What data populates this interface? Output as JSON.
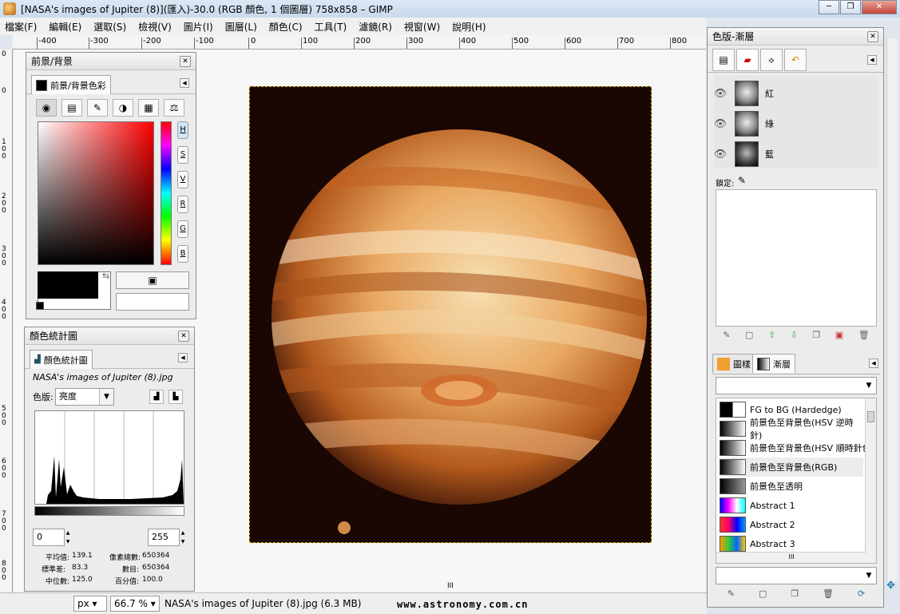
{
  "window": {
    "title": "[NASA's images of Jupiter (8)](匯入)-30.0 (RGB 顏色, 1 個圖層) 758x858 – GIMP",
    "minimize": "─",
    "maximize": "❐",
    "close": "✕"
  },
  "menubar": [
    "檔案(F)",
    "編輯(E)",
    "選取(S)",
    "檢視(V)",
    "圖片(I)",
    "圖層(L)",
    "顏色(C)",
    "工具(T)",
    "濾鏡(R)",
    "視窗(W)",
    "說明(H)"
  ],
  "ruler_top": {
    "labels": [
      "-400",
      "-300",
      "-200",
      "-100",
      "0",
      "100",
      "200",
      "300",
      "400",
      "500",
      "600",
      "700",
      "800"
    ]
  },
  "ruler_left": {
    "labels": [
      "0",
      "0",
      "100",
      "200",
      "300",
      "400",
      "500",
      "600",
      "700",
      "800"
    ]
  },
  "fg_bg_panel": {
    "title": "前景/背景",
    "tab_label": "前景/背景色彩",
    "hsv_buttons": [
      "H",
      "S",
      "V",
      "R",
      "G",
      "B"
    ],
    "fg_color": "#000000",
    "bg_color": "#ffffff"
  },
  "histogram_panel": {
    "title": "顏色統計圖",
    "tab_label": "顏色統計圖",
    "filename": "NASA's images of Jupiter (8).jpg",
    "channel_label": "色版:",
    "channel_value": "亮度",
    "range_min": "0",
    "range_max": "255",
    "stats": {
      "mean_label": "平均值:",
      "mean": "139.1",
      "std_label": "標準差:",
      "std": "83.3",
      "median_label": "中位數:",
      "median": "125.0",
      "pixels_label": "像素總數:",
      "pixels": "650364",
      "count_label": "數目:",
      "count": "650364",
      "percentile_label": "百分值:",
      "percentile": "100.0"
    }
  },
  "layers_panel": {
    "title": "色版-漸層",
    "channels": [
      {
        "name": "紅"
      },
      {
        "name": "綠"
      },
      {
        "name": "藍"
      }
    ],
    "lock_label": "鎖定:"
  },
  "gradients_panel": {
    "tab_pattern": "圖樣",
    "tab_gradient": "漸層",
    "items": [
      {
        "name": "FG to BG (Hardedge)"
      },
      {
        "name": "前景色至背景色(HSV 逆時針)"
      },
      {
        "name": "前景色至背景色(HSV 順時針色相)"
      },
      {
        "name": "前景色至背景色(RGB)"
      },
      {
        "name": "前景色至透明"
      },
      {
        "name": "Abstract 1"
      },
      {
        "name": "Abstract 2"
      },
      {
        "name": "Abstract 3"
      }
    ],
    "scroll_mid": "III"
  },
  "statusbar": {
    "unit": "px",
    "zoom": "66.7 %",
    "file_info": "NASA's images of Jupiter (8).jpg (6.3 MB)",
    "watermark": "www.astronomy.com.cn"
  },
  "canvas_scroll_mid": "III"
}
